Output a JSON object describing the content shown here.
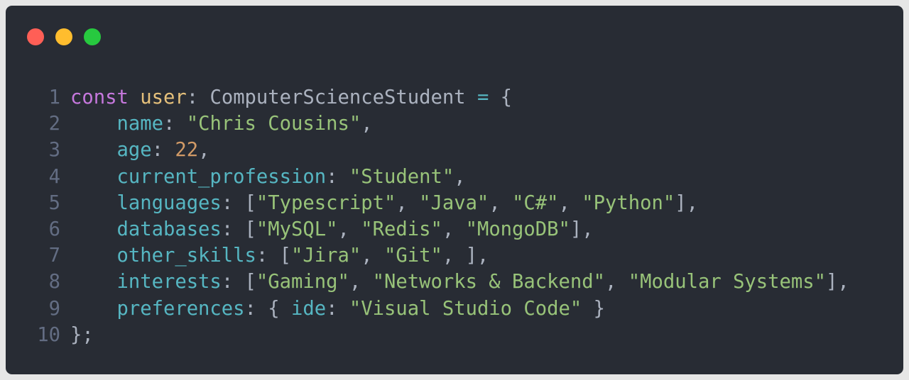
{
  "window": {
    "controls": [
      "close",
      "minimize",
      "maximize"
    ],
    "colors": {
      "background": "#282c34",
      "close": "#ff5f56",
      "minimize": "#ffbd2e",
      "maximize": "#27c93f",
      "keyword": "#c678dd",
      "variable": "#e5c07b",
      "property": "#56b6c2",
      "string": "#98c379",
      "number": "#d19a66",
      "punctuation": "#abb2bf",
      "line_number": "#636d83"
    }
  },
  "code": {
    "lines": [
      {
        "number": "1",
        "tokens": [
          {
            "t": "keyword",
            "v": "const"
          },
          {
            "t": "punc",
            "v": " "
          },
          {
            "t": "var",
            "v": "user"
          },
          {
            "t": "punc",
            "v": ": "
          },
          {
            "t": "type",
            "v": "ComputerScienceStudent"
          },
          {
            "t": "punc",
            "v": " "
          },
          {
            "t": "op",
            "v": "="
          },
          {
            "t": "punc",
            "v": " {"
          }
        ]
      },
      {
        "number": "2",
        "tokens": [
          {
            "t": "punc",
            "v": "    "
          },
          {
            "t": "prop",
            "v": "name"
          },
          {
            "t": "punc",
            "v": ": "
          },
          {
            "t": "string",
            "v": "\"Chris Cousins\""
          },
          {
            "t": "punc",
            "v": ","
          }
        ]
      },
      {
        "number": "3",
        "tokens": [
          {
            "t": "punc",
            "v": "    "
          },
          {
            "t": "prop",
            "v": "age"
          },
          {
            "t": "punc",
            "v": ": "
          },
          {
            "t": "number",
            "v": "22"
          },
          {
            "t": "punc",
            "v": ","
          }
        ]
      },
      {
        "number": "4",
        "tokens": [
          {
            "t": "punc",
            "v": "    "
          },
          {
            "t": "prop",
            "v": "current_profession"
          },
          {
            "t": "punc",
            "v": ": "
          },
          {
            "t": "string",
            "v": "\"Student\""
          },
          {
            "t": "punc",
            "v": ","
          }
        ]
      },
      {
        "number": "5",
        "tokens": [
          {
            "t": "punc",
            "v": "    "
          },
          {
            "t": "prop",
            "v": "languages"
          },
          {
            "t": "punc",
            "v": ": ["
          },
          {
            "t": "string",
            "v": "\"Typescript\""
          },
          {
            "t": "punc",
            "v": ", "
          },
          {
            "t": "string",
            "v": "\"Java\""
          },
          {
            "t": "punc",
            "v": ", "
          },
          {
            "t": "string",
            "v": "\"C#\""
          },
          {
            "t": "punc",
            "v": ", "
          },
          {
            "t": "string",
            "v": "\"Python\""
          },
          {
            "t": "punc",
            "v": "],"
          }
        ]
      },
      {
        "number": "6",
        "tokens": [
          {
            "t": "punc",
            "v": "    "
          },
          {
            "t": "prop",
            "v": "databases"
          },
          {
            "t": "punc",
            "v": ": ["
          },
          {
            "t": "string",
            "v": "\"MySQL\""
          },
          {
            "t": "punc",
            "v": ", "
          },
          {
            "t": "string",
            "v": "\"Redis\""
          },
          {
            "t": "punc",
            "v": ", "
          },
          {
            "t": "string",
            "v": "\"MongoDB\""
          },
          {
            "t": "punc",
            "v": "],"
          }
        ]
      },
      {
        "number": "7",
        "tokens": [
          {
            "t": "punc",
            "v": "    "
          },
          {
            "t": "prop",
            "v": "other_skills"
          },
          {
            "t": "punc",
            "v": ": ["
          },
          {
            "t": "string",
            "v": "\"Jira\""
          },
          {
            "t": "punc",
            "v": ", "
          },
          {
            "t": "string",
            "v": "\"Git\""
          },
          {
            "t": "punc",
            "v": ", ],"
          }
        ]
      },
      {
        "number": "8",
        "tokens": [
          {
            "t": "punc",
            "v": "    "
          },
          {
            "t": "prop",
            "v": "interests"
          },
          {
            "t": "punc",
            "v": ": ["
          },
          {
            "t": "string",
            "v": "\"Gaming\""
          },
          {
            "t": "punc",
            "v": ", "
          },
          {
            "t": "string",
            "v": "\"Networks & Backend\""
          },
          {
            "t": "punc",
            "v": ", "
          },
          {
            "t": "string",
            "v": "\"Modular Systems\""
          },
          {
            "t": "punc",
            "v": "],"
          }
        ]
      },
      {
        "number": "9",
        "tokens": [
          {
            "t": "punc",
            "v": "    "
          },
          {
            "t": "prop",
            "v": "preferences"
          },
          {
            "t": "punc",
            "v": ": { "
          },
          {
            "t": "prop",
            "v": "ide"
          },
          {
            "t": "punc",
            "v": ": "
          },
          {
            "t": "string",
            "v": "\"Visual Studio Code\""
          },
          {
            "t": "punc",
            "v": " }"
          }
        ]
      },
      {
        "number": "10",
        "tokens": [
          {
            "t": "punc",
            "v": "};"
          }
        ]
      }
    ]
  }
}
